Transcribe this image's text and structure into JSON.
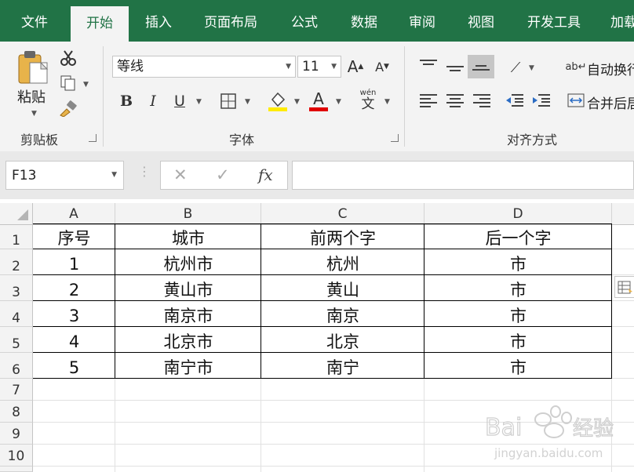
{
  "tabs": [
    "文件",
    "开始",
    "插入",
    "页面布局",
    "公式",
    "数据",
    "审阅",
    "视图",
    "开发工具",
    "加载"
  ],
  "active_tab": "开始",
  "clipboard": {
    "paste_label": "粘贴",
    "group_label": "剪贴板"
  },
  "font": {
    "name": "等线",
    "size": "11",
    "group_label": "字体",
    "fill_color": "#ffeb00",
    "font_color": "#e00000"
  },
  "alignment": {
    "wrap_label": "自动换行",
    "merge_label": "合并后居",
    "group_label": "对齐方式"
  },
  "formula_bar": {
    "name_box": "F13",
    "cancel": "✕",
    "enter": "✓",
    "fx": "fx",
    "formula": ""
  },
  "sheet": {
    "columns": [
      "A",
      "B",
      "C",
      "D"
    ],
    "row_numbers": [
      "1",
      "2",
      "3",
      "4",
      "5",
      "6",
      "7",
      "8",
      "9",
      "10"
    ],
    "rows": [
      [
        "序号",
        "城市",
        "前两个字",
        "后一个字"
      ],
      [
        "1",
        "杭州市",
        "杭州",
        "市"
      ],
      [
        "2",
        "黄山市",
        "黄山",
        "市"
      ],
      [
        "3",
        "南京市",
        "南京",
        "市"
      ],
      [
        "4",
        "北京市",
        "北京",
        "市"
      ],
      [
        "5",
        "南宁市",
        "南宁",
        "市"
      ]
    ]
  },
  "watermark": {
    "logo": "Bai 经验",
    "url": "jingyan.baidu.com"
  }
}
